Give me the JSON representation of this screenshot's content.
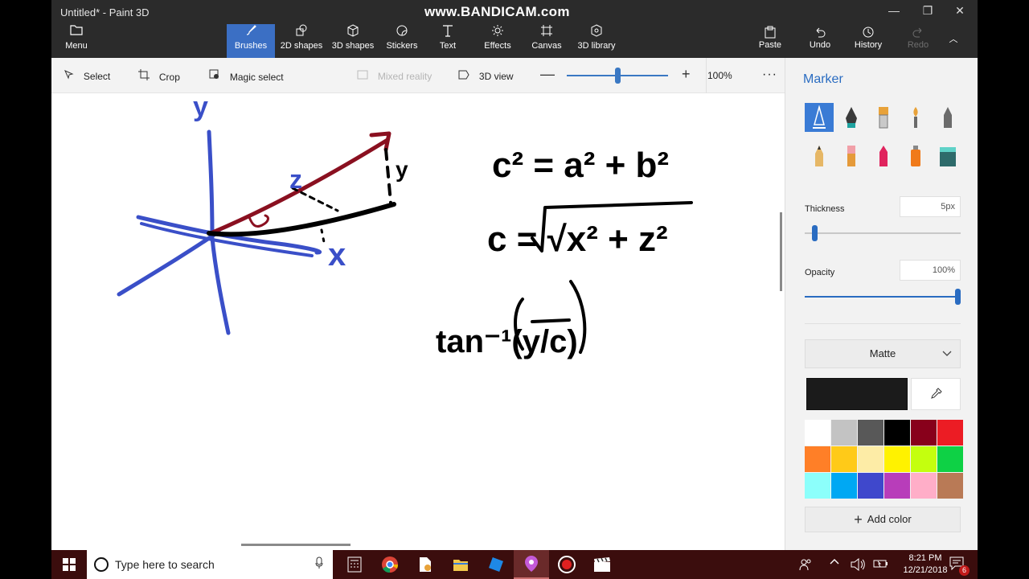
{
  "window": {
    "title": "Untitled* - Paint 3D",
    "watermark": "www.BANDICAM.com",
    "minimize_glyph": "—",
    "restore_glyph": "❐",
    "close_glyph": "✕"
  },
  "ribbon": {
    "menu_label": "Menu",
    "tools": [
      {
        "label": "Brushes",
        "icon": "brush-icon"
      },
      {
        "label": "2D shapes",
        "icon": "shapes-2d-icon"
      },
      {
        "label": "3D shapes",
        "icon": "cube-icon"
      },
      {
        "label": "Stickers",
        "icon": "sticker-icon"
      },
      {
        "label": "Text",
        "icon": "text-icon"
      },
      {
        "label": "Effects",
        "icon": "sun-icon"
      },
      {
        "label": "Canvas",
        "icon": "canvas-icon"
      },
      {
        "label": "3D library",
        "icon": "library-icon"
      }
    ],
    "active_tool": "Brushes",
    "right": [
      {
        "label": "Paste",
        "icon": "paste-icon"
      },
      {
        "label": "Undo",
        "icon": "undo-icon"
      },
      {
        "label": "History",
        "icon": "history-icon"
      },
      {
        "label": "Redo",
        "icon": "redo-icon"
      }
    ],
    "collapse_glyph": "︿"
  },
  "toolbar": {
    "select": "Select",
    "crop": "Crop",
    "magic_select": "Magic select",
    "mixed_reality": "Mixed reality",
    "view_3d": "3D view",
    "zoom_minus": "—",
    "zoom_plus": "+",
    "zoom_value": "100%",
    "zoom_fraction": 0.5,
    "more": "···"
  },
  "panel": {
    "title": "Marker",
    "brushes": [
      {
        "name": "marker",
        "icon": "marker-brush-icon"
      },
      {
        "name": "calligraphy-pen",
        "icon": "calligraphy-pen-icon"
      },
      {
        "name": "oil-brush",
        "icon": "oil-brush-icon"
      },
      {
        "name": "watercolor",
        "icon": "watercolor-icon"
      },
      {
        "name": "pixel-pen",
        "icon": "pixel-pen-icon"
      },
      {
        "name": "pencil",
        "icon": "pencil-icon"
      },
      {
        "name": "eraser",
        "icon": "eraser-icon"
      },
      {
        "name": "crayon",
        "icon": "crayon-icon"
      },
      {
        "name": "spray-can",
        "icon": "spray-can-icon"
      },
      {
        "name": "fill",
        "icon": "fill-bucket-icon"
      }
    ],
    "thickness_label": "Thickness",
    "thickness_value": "5px",
    "thickness_fraction": 0.05,
    "opacity_label": "Opacity",
    "opacity_value": "100%",
    "opacity_fraction": 1.0,
    "finish": "Matte",
    "current_color": "#1b1b1b",
    "palette": [
      "#ffffff",
      "#c3c3c3",
      "#585858",
      "#000000",
      "#88001b",
      "#ec1c24",
      "#ff7f27",
      "#ffca18",
      "#fdeca6",
      "#fff200",
      "#c4ff0e",
      "#0ed145",
      "#8cfffb",
      "#00a8f3",
      "#3f48cc",
      "#b83dba",
      "#ffaec8",
      "#b97a56"
    ],
    "add_color": "Add color"
  },
  "drawing": {
    "blue": "#3a4fc8",
    "red": "#8a1020",
    "black": "#000000",
    "labels": {
      "axis_y": "y",
      "axis_z": "z",
      "axis_x": "x",
      "side_y": "y"
    },
    "equations": {
      "eq1": "c² = a² + b²",
      "eq2": "c = √x² + z²",
      "eq3": "tan⁻¹(y/c)"
    }
  },
  "taskbar": {
    "search_placeholder": "Type here to search",
    "apps": [
      "calculator-icon",
      "chrome-icon",
      "files-icon",
      "file-explorer-icon",
      "blue-app-icon",
      "paint3d-icon",
      "record-icon",
      "clapper-icon"
    ],
    "time": "8:21 PM",
    "date": "12/21/2018",
    "notifications": "6"
  }
}
